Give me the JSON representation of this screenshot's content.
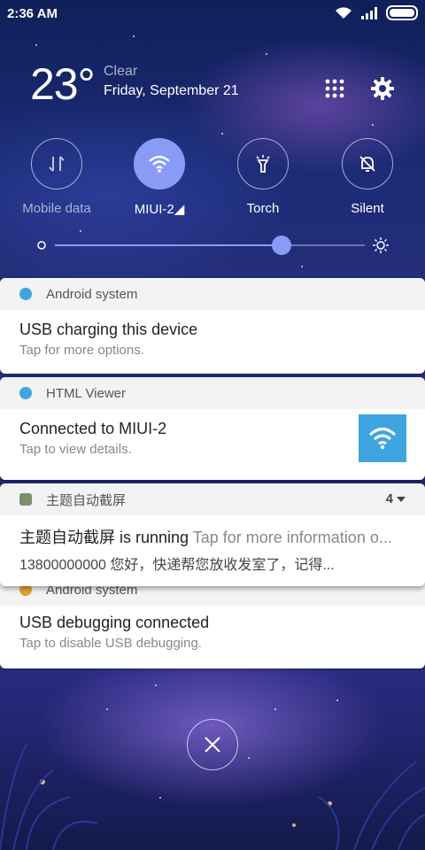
{
  "status_bar": {
    "time": "2:36 AM",
    "icons": [
      "wifi-icon",
      "signal-icon",
      "battery-icon"
    ]
  },
  "weather": {
    "temperature": "23°",
    "condition": "Clear",
    "date": "Friday, September 21"
  },
  "header_actions": [
    "grid-icon",
    "gear-icon"
  ],
  "quick_toggles": [
    {
      "label": "Mobile data",
      "icon": "mobile-data-icon",
      "active": false
    },
    {
      "label": "MIUI-2◢",
      "icon": "wifi-icon",
      "active": true
    },
    {
      "label": "Torch",
      "icon": "torch-icon",
      "active": false
    },
    {
      "label": "Silent",
      "icon": "bell-off-icon",
      "active": false
    }
  ],
  "brightness": {
    "level": 0.73,
    "accent": "#8a9bf5"
  },
  "notifications": [
    {
      "app": "Android system",
      "title": "USB charging this device",
      "subtitle": "Tap for more options.",
      "icon_color": "#3fa5e0"
    },
    {
      "app": "HTML Viewer",
      "title": "Connected to MIUI-2",
      "subtitle": "Tap to view details.",
      "icon_color": "#3fa5e0",
      "thumb_color": "#3fa5e0"
    },
    {
      "app": "主题自动截屏",
      "count": "4",
      "title": "主题自动截屏 is running",
      "title_suffix": "Tap for more information o...",
      "subtitle": "13800000000 您好，快递帮您放收发室了，记得...",
      "icon_color": "#7a8f6b"
    },
    {
      "app": "Android system",
      "title": "USB debugging connected",
      "subtitle": "Tap to disable USB debugging."
    }
  ],
  "close_button_icon": "close-icon"
}
